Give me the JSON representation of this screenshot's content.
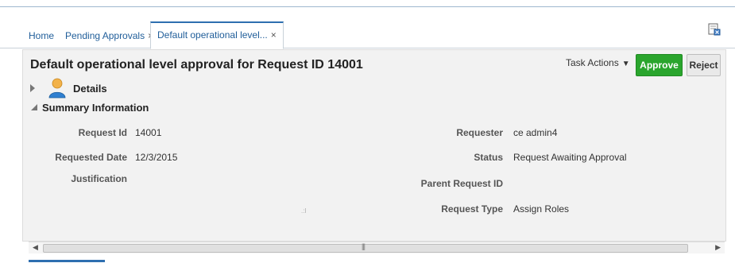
{
  "tabs": [
    {
      "label": "Home",
      "closable": false,
      "active": false
    },
    {
      "label": "Pending Approvals",
      "closable": true,
      "active": false
    },
    {
      "label": "Default operational level...",
      "closable": true,
      "active": true
    }
  ],
  "close_glyph": "×",
  "page_title": "Default operational level approval for Request ID 14001",
  "toolbar": {
    "task_actions_label": "Task Actions",
    "approve_label": "Approve",
    "reject_label": "Reject"
  },
  "sections": {
    "details_label": "Details",
    "summary_label": "Summary Information"
  },
  "fields_left": [
    {
      "label": "Request Id",
      "value": "14001"
    },
    {
      "label": "Requested Date",
      "value": "12/3/2015"
    },
    {
      "label": "Justification",
      "value": ""
    }
  ],
  "fields_right": [
    {
      "label": "Requester",
      "value": "ce admin4"
    },
    {
      "label": "Status",
      "value": "Request Awaiting Approval"
    },
    {
      "label": "Parent Request ID",
      "value": ""
    },
    {
      "label": "Request Type",
      "value": "Assign Roles"
    }
  ],
  "colors": {
    "accent_blue": "#2e6fb0",
    "approve_green": "#2aa52d",
    "panel_bg": "#f2f2f2"
  },
  "icons": {
    "tabbar_right": "export-icon",
    "details": "person-icon"
  }
}
